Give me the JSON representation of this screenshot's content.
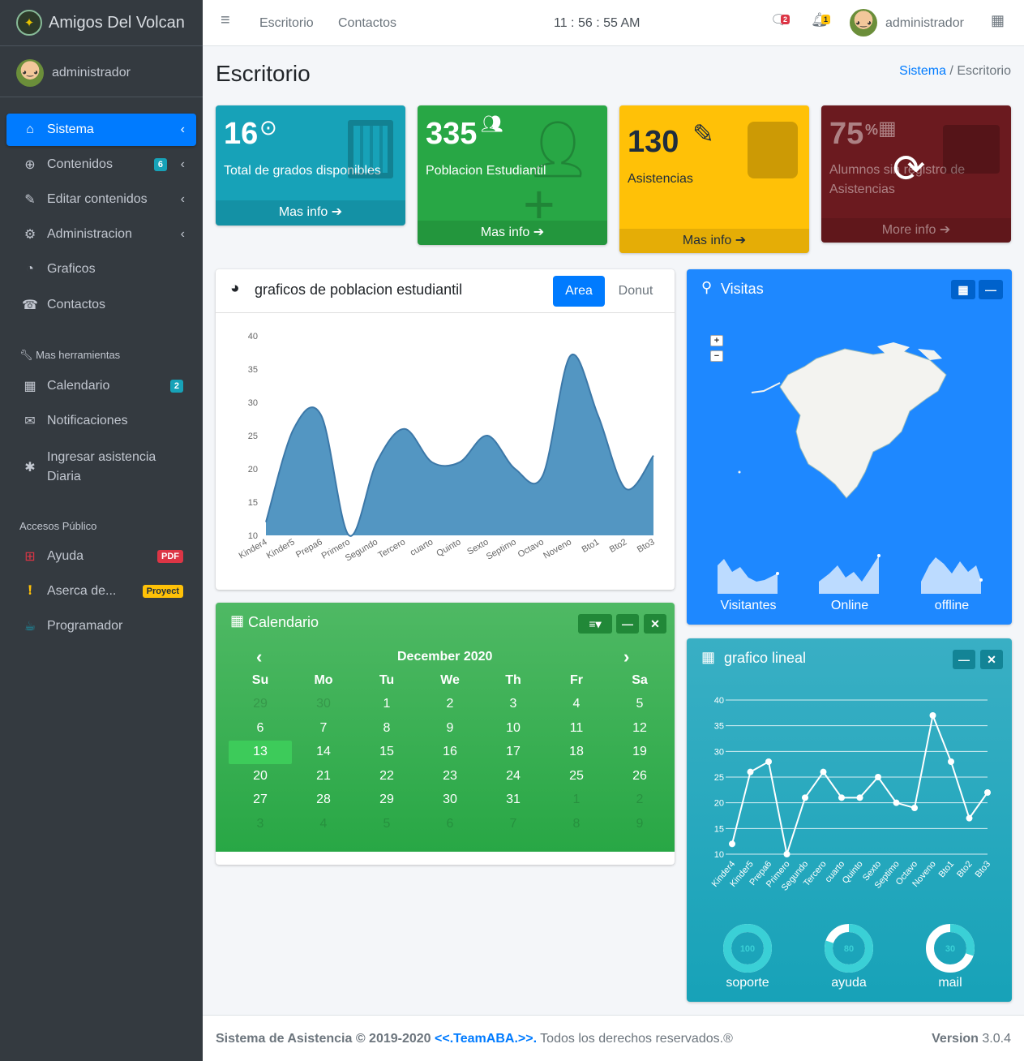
{
  "brand": {
    "name": "Amigos Del Volcan"
  },
  "user": {
    "name": "administrador"
  },
  "sidebar": {
    "items": [
      {
        "label": "Sistema",
        "icon": "home-icon"
      },
      {
        "label": "Contenidos",
        "icon": "crosshairs-icon",
        "badge": "6"
      },
      {
        "label": "Editar contenidos",
        "icon": "edit-icon"
      },
      {
        "label": "Administracion",
        "icon": "cogs-icon"
      },
      {
        "label": "Graficos",
        "icon": "pie-chart-icon"
      },
      {
        "label": "Contactos",
        "icon": "phone-icon"
      }
    ],
    "tools_header": "Mas herramientas",
    "tools": [
      {
        "label": "Calendario",
        "badge": "2"
      },
      {
        "label": "Notificaciones"
      },
      {
        "label": "Ingresar asistencia",
        "label2": "Diaria"
      }
    ],
    "public_header": "Accesos Público",
    "public": [
      {
        "label": "Ayuda",
        "badge": "PDF"
      },
      {
        "label": "Aserca de...",
        "badge": "Proyect"
      },
      {
        "label": "Programador"
      }
    ]
  },
  "topbar": {
    "links": [
      "Escritorio",
      "Contactos"
    ],
    "clock": "11 : 56 : 55 AM",
    "messages_count": "2",
    "notifications_count": "1",
    "user": "administrador"
  },
  "page": {
    "title": "Escritorio",
    "breadcrumb": [
      "Sistema",
      "Escritorio"
    ]
  },
  "stats": [
    {
      "number": "16",
      "label": "Total de grados disponibles",
      "footer": "Mas info",
      "color": "#17a2b8"
    },
    {
      "number": "335",
      "label": "Poblacion Estudiantil",
      "footer": "Mas info",
      "color": "#28a745"
    },
    {
      "number": "130",
      "label": "Asistencias",
      "footer": "Mas info",
      "color": "#ffc107"
    },
    {
      "number": "75",
      "suffix": "%",
      "label": "Alumnos sin registro de Asistencias",
      "footer": "More info",
      "color": "#6b1a1f"
    }
  ],
  "population_card": {
    "title": "graficos de poblacion estudiantil",
    "tab_active": "Area",
    "tab_other": "Donut"
  },
  "visits_card": {
    "title": "Visitas",
    "sparks": [
      "Visitantes",
      "Online",
      "offline"
    ]
  },
  "calendar_card": {
    "title": "Calendario",
    "month": "December 2020",
    "weekdays": [
      "Su",
      "Mo",
      "Tu",
      "We",
      "Th",
      "Fr",
      "Sa"
    ],
    "weeks": [
      [
        "29",
        "30",
        "1",
        "2",
        "3",
        "4",
        "5"
      ],
      [
        "6",
        "7",
        "8",
        "9",
        "10",
        "11",
        "12"
      ],
      [
        "13",
        "14",
        "15",
        "16",
        "17",
        "18",
        "19"
      ],
      [
        "20",
        "21",
        "22",
        "23",
        "24",
        "25",
        "26"
      ],
      [
        "27",
        "28",
        "29",
        "30",
        "31",
        "1",
        "2"
      ],
      [
        "3",
        "4",
        "5",
        "6",
        "7",
        "8",
        "9"
      ]
    ],
    "selected": "13"
  },
  "line_card": {
    "title": "grafico lineal",
    "knobs": [
      {
        "label": "soporte",
        "value": "100"
      },
      {
        "label": "ayuda",
        "value": "80"
      },
      {
        "label": "mail",
        "value": "30"
      }
    ]
  },
  "footer": {
    "left": "Sistema de Asistencia © 2019-2020",
    "team": "<<.TeamABA.>>.",
    "rights": "Todos los derechos reservados.®",
    "version_label": "Version",
    "version": "3.0.4"
  },
  "chart_data": [
    {
      "type": "area",
      "categories": [
        "Kinder4",
        "Kinder5",
        "Prepa6",
        "Primero",
        "Segundo",
        "Tercero",
        "cuarto",
        "Quinto",
        "Sexto",
        "Septimo",
        "Octavo",
        "Noveno",
        "Bto1",
        "Bto2",
        "Bto3"
      ],
      "values": [
        12,
        26,
        28,
        10,
        21,
        26,
        21,
        21,
        25,
        20,
        19,
        37,
        28,
        17,
        22
      ],
      "yticks": [
        10,
        15,
        20,
        25,
        30,
        35,
        40
      ],
      "ylim": [
        10,
        40
      ],
      "color": "#3c8dbc"
    },
    {
      "type": "line",
      "categories": [
        "Kinder4",
        "Kinder5",
        "Prepa6",
        "Primero",
        "Segundo",
        "Tercero",
        "cuarto",
        "Quinto",
        "Sexto",
        "Septimo",
        "Octavo",
        "Noveno",
        "Bto1",
        "Bto2",
        "Bto3"
      ],
      "values": [
        12,
        26,
        28,
        10,
        21,
        26,
        21,
        21,
        25,
        20,
        19,
        37,
        28,
        17,
        22
      ],
      "yticks": [
        10,
        15,
        20,
        25,
        30,
        35,
        40
      ],
      "ylim": [
        10,
        40
      ],
      "grid": true,
      "color": "#ffffff"
    }
  ]
}
